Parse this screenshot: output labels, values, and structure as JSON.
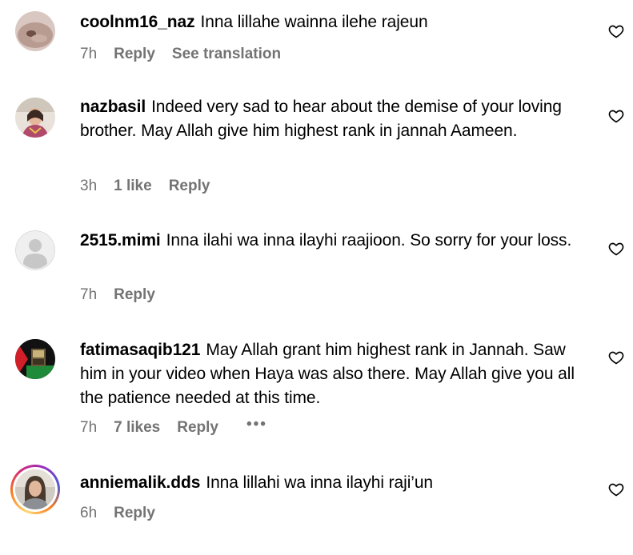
{
  "comments": [
    {
      "username": "coolnm16_naz",
      "text": "Inna lillahe wainna ilehe rajeun",
      "time": "7h",
      "likes": "",
      "reply": "Reply",
      "translate": "See translation"
    },
    {
      "username": "nazbasil",
      "text": "Indeed very sad to hear about the demise of your loving brother. May Allah give him highest rank in jannah Aameen.",
      "time": "3h",
      "likes": "1 like",
      "reply": "Reply",
      "translate": ""
    },
    {
      "username": "2515.mimi",
      "text": "Inna ilahi wa inna ilayhi raajioon. So sorry for your loss.",
      "time": "7h",
      "likes": "",
      "reply": "Reply",
      "translate": ""
    },
    {
      "username": "fatimasaqib121",
      "text": "May Allah grant him highest rank in Jannah. Saw him in your video when Haya was also there. May Allah give you all the patience needed at this time.",
      "time": "7h",
      "likes": "7 likes",
      "reply": "Reply",
      "translate": "",
      "more": "•••"
    },
    {
      "username": "anniemalik.dds",
      "text": "Inna lillahi wa inna ilayhi raji’un",
      "time": "6h",
      "likes": "",
      "reply": "Reply",
      "translate": ""
    }
  ],
  "colors": {
    "text": "#000000",
    "meta": "#737373",
    "background": "#ffffff"
  },
  "icons": {
    "like": "heart-outline-icon",
    "default_avatar": "default-avatar-icon"
  }
}
